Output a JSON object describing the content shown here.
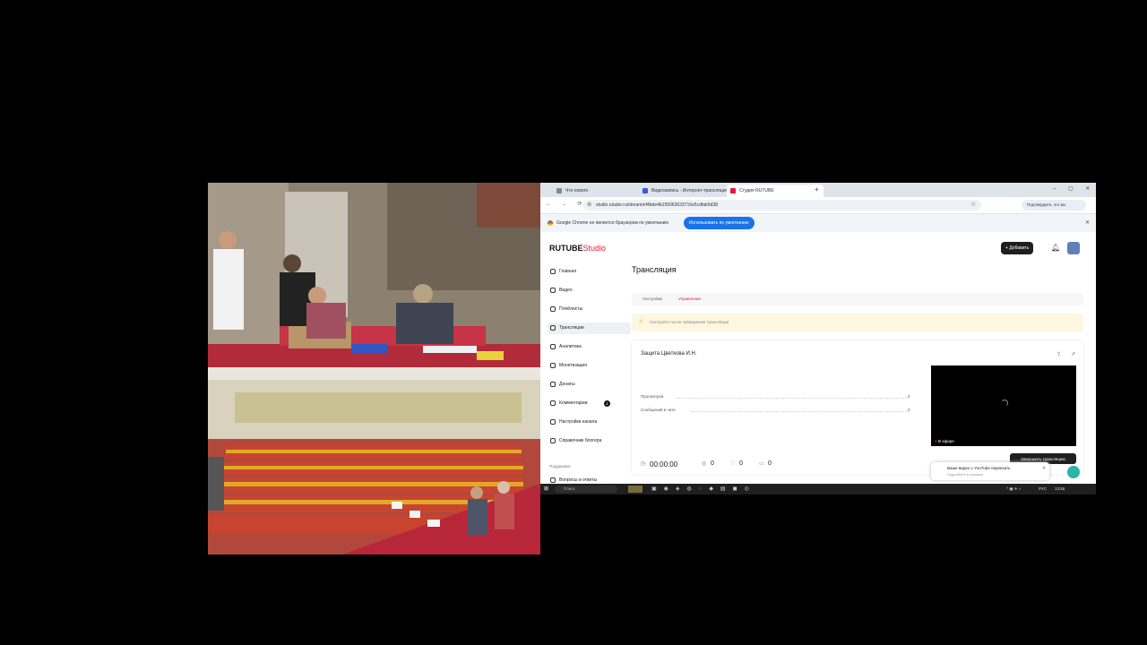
{
  "browser": {
    "tabs": [
      {
        "label": "Что нового"
      },
      {
        "label": "Видеозапись - Интернет-трансляция"
      },
      {
        "label": "Студия RUTUBE"
      }
    ],
    "url": "studio.rutube.ru/stream/ef4bde4b155063633716e5cdfab5d38",
    "infobar": {
      "text": "Google Chrome не является браузером по умолчанию",
      "button": "Использовать по умолчанию"
    },
    "profile": "Подтвердите, это вы"
  },
  "studio": {
    "logo_main": "RUTUBE",
    "logo_studio": "Studio",
    "add_button": "Добавить",
    "sidebar": [
      {
        "label": "Главная"
      },
      {
        "label": "Видео"
      },
      {
        "label": "Плейлисты"
      },
      {
        "label": "Трансляции"
      },
      {
        "label": "Аналитика"
      },
      {
        "label": "Монетизация"
      },
      {
        "label": "Донаты"
      },
      {
        "label": "Комментарии",
        "badge": "1"
      },
      {
        "label": "Настройки канала"
      },
      {
        "label": "Справочник блогера"
      }
    ],
    "support_title": "Поддержка",
    "support_item": "Вопросы и ответы",
    "page_title": "Трансляция",
    "tabs": [
      "Настройки",
      "Управление"
    ],
    "notice": "Настройте после завершения трансляции",
    "stream_title": "Защита Цветкова И.Н.",
    "stats": [
      {
        "label": "Просмотров",
        "value": "0"
      },
      {
        "label": "Сообщений в чате",
        "value": "0"
      }
    ],
    "timer": "00:00:00",
    "counters": [
      "0",
      "0",
      "0"
    ],
    "live_badge": "В эфире",
    "end_button": "Завершить трансляцию",
    "toast": {
      "title": "Ваше видео с YouTube переехать",
      "subtitle": "Подробнее в сервисе"
    }
  },
  "taskbar": {
    "search": "Поиск",
    "lang": "РУС",
    "time": "13:55"
  },
  "colors": {
    "accent": "#e5173f",
    "blue": "#1a73e8",
    "dark": "#1f1f1f"
  }
}
